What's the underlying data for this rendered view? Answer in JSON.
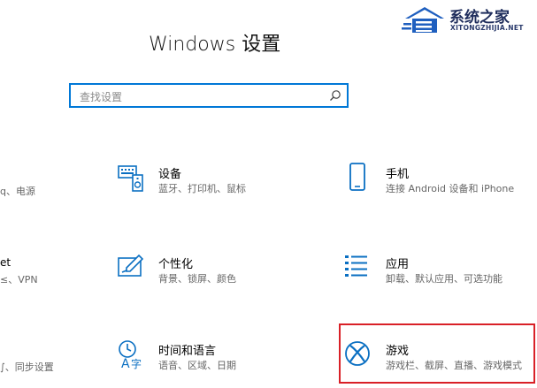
{
  "window": {
    "title": "Windows 设置"
  },
  "search": {
    "placeholder": "查找设置"
  },
  "left_fragments": [
    {
      "text": "蓝牙、打印机、鼠标",
      "partial": "q、电源"
    },
    {
      "text": "et"
    },
    {
      "text": "≤、VPN"
    },
    {
      "text": "∫、同步设置"
    }
  ],
  "settings": [
    {
      "id": "devices",
      "name": "设备",
      "desc": "蓝牙、打印机、鼠标",
      "icon": "devices-icon"
    },
    {
      "id": "phone",
      "name": "手机",
      "desc": "连接 Android 设备和 iPhone",
      "icon": "phone-icon"
    },
    {
      "id": "personalization",
      "name": "个性化",
      "desc": "背景、锁屏、颜色",
      "icon": "personalization-icon"
    },
    {
      "id": "apps",
      "name": "应用",
      "desc": "卸载、默认应用、可选功能",
      "icon": "apps-icon"
    },
    {
      "id": "time-language",
      "name": "时间和语言",
      "desc": "语音、区域、日期",
      "icon": "time-language-icon"
    },
    {
      "id": "gaming",
      "name": "游戏",
      "desc": "游戏栏、截屏、直播、游戏模式",
      "icon": "xbox-icon"
    }
  ],
  "watermark": {
    "brand": "系统之家",
    "url": "XITONGZHIJIA.NET"
  },
  "colors": {
    "accent": "#0078d7",
    "highlight": "#d92027"
  }
}
